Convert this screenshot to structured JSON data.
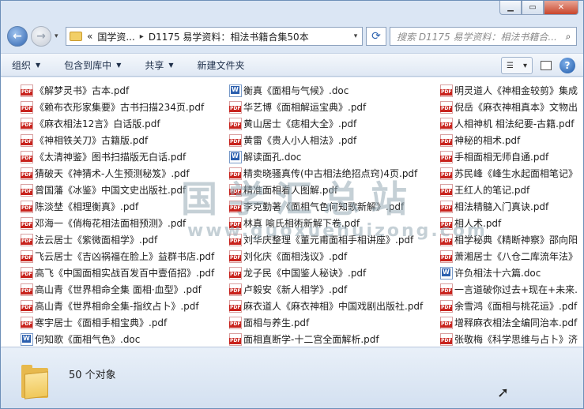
{
  "address": {
    "recent_arrow": "▾",
    "crumbs": [
      "«",
      "国学资...",
      "D1175 易学资料：相法书籍合集50本"
    ],
    "sep": "▸",
    "search_placeholder": "搜索 D1175 易学资料：相法书籍合..."
  },
  "toolbar": {
    "organize": "组织",
    "include": "包含到库中",
    "share": "共享",
    "new_folder": "新建文件夹"
  },
  "files": [
    [
      {
        "name": "《解梦灵书》古本.pdf",
        "type": "pdf"
      },
      {
        "name": "《赖布衣形家集要》古书扫描234页.pdf",
        "type": "pdf"
      },
      {
        "name": "《麻衣相法12言》白话版.pdf",
        "type": "pdf"
      },
      {
        "name": "《神相铁关刀》古籍版.pdf",
        "type": "pdf"
      },
      {
        "name": "《太清神鉴》图书扫描版无白话.pdf",
        "type": "pdf"
      },
      {
        "name": "猜破天《神猜术-人生预测秘笈》.pdf",
        "type": "pdf"
      },
      {
        "name": "曾国藩《冰鉴》中国文史出版社.pdf",
        "type": "pdf"
      },
      {
        "name": "陈淡埜《相理衡真》.pdf",
        "type": "pdf"
      },
      {
        "name": "邓海一《俏梅花相法面相预测》.pdf",
        "type": "pdf"
      },
      {
        "name": "法云居士《紫微面相学》.pdf",
        "type": "pdf"
      },
      {
        "name": "飞云居士《吉凶祸福在脸上》益群书店.pdf",
        "type": "pdf"
      },
      {
        "name": "高飞《中国面相实战百发百中壹佰招》.pdf",
        "type": "pdf"
      },
      {
        "name": "高山青《世界相命全集 面相·血型》.pdf",
        "type": "pdf"
      },
      {
        "name": "高山青《世界相命全集-指纹占卜》.pdf",
        "type": "pdf"
      },
      {
        "name": "寒宇居士《面相手相宝典》.pdf",
        "type": "pdf"
      },
      {
        "name": "何知歌《面相气色》.doc",
        "type": "doc"
      }
    ],
    [
      {
        "name": "衡真《面相与气候》.doc",
        "type": "doc"
      },
      {
        "name": "华艺博《面相解运宝典》.pdf",
        "type": "pdf"
      },
      {
        "name": "黄山居士《痣相大全》.pdf",
        "type": "pdf"
      },
      {
        "name": "黄雷《贵人小人相法》.pdf",
        "type": "pdf"
      },
      {
        "name": "解读面孔.doc",
        "type": "doc"
      },
      {
        "name": "精卖晓骚真传(中古相法绝招点窍)4页.pdf",
        "type": "pdf"
      },
      {
        "name": "精准面相看人图解.pdf",
        "type": "pdf"
      },
      {
        "name": "李克勤著《面相气色何知歌新解》.pdf",
        "type": "pdf"
      },
      {
        "name": "林真 喻氏相術新解下卷.pdf",
        "type": "pdf"
      },
      {
        "name": "刘华庆整理《董元甫面相手相讲座》.pdf",
        "type": "pdf"
      },
      {
        "name": "刘化庆《面相浅议》.pdf",
        "type": "pdf"
      },
      {
        "name": "龙子民《中国鉴人秘诀》.pdf",
        "type": "pdf"
      },
      {
        "name": "卢毅安《新人相学》.pdf",
        "type": "pdf"
      },
      {
        "name": "麻衣道人《麻衣神相》中国戏剧出版社.pdf",
        "type": "pdf"
      },
      {
        "name": "面相与养生.pdf",
        "type": "pdf"
      },
      {
        "name": "面相直断学-十二宫全面解析.pdf",
        "type": "pdf"
      }
    ],
    [
      {
        "name": "明灵道人《神相金较剪》集成",
        "type": "pdf"
      },
      {
        "name": "倪岳《麻衣神相真本》文物出",
        "type": "pdf"
      },
      {
        "name": "人相神机 相法纪要-古籍.pdf",
        "type": "pdf"
      },
      {
        "name": "神秘的相术.pdf",
        "type": "pdf"
      },
      {
        "name": "手相面相无师自通.pdf",
        "type": "pdf"
      },
      {
        "name": "苏民峰《峰生水起面相笔记》",
        "type": "pdf"
      },
      {
        "name": "王红人的笔记.pdf",
        "type": "pdf"
      },
      {
        "name": "相法精髓入门真诀.pdf",
        "type": "pdf"
      },
      {
        "name": "相人术.pdf",
        "type": "pdf"
      },
      {
        "name": "相学秘典《精断神察》邵向阳",
        "type": "pdf"
      },
      {
        "name": "萧湘居士《八仓二库流年法》",
        "type": "pdf"
      },
      {
        "name": "许负相法十六篇.doc",
        "type": "doc"
      },
      {
        "name": "一言道破你过去+现在+未来.",
        "type": "pdf"
      },
      {
        "name": "余雪鸿《面相与桃花运》.pdf",
        "type": "pdf"
      },
      {
        "name": "增释麻衣相法全编同治本.pdf",
        "type": "pdf"
      },
      {
        "name": "张敬梅《科学思维与占卜》济",
        "type": "pdf"
      }
    ]
  ],
  "watermark": {
    "title": "国学汇总站",
    "url": "www.guoxuehuizong.com"
  },
  "status": {
    "count": "50 个对象"
  },
  "colors": {
    "accent": "#2f64b0",
    "pdf_icon": "#c8231d",
    "doc_icon": "#2b5fae"
  }
}
